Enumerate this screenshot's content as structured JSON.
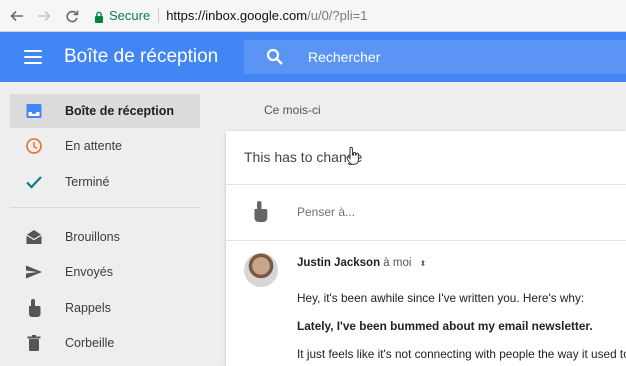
{
  "browser": {
    "secure_label": "Secure",
    "url_host": "https://inbox.google.com",
    "url_path": "/u/0/?pli=1"
  },
  "header": {
    "title": "Boîte de réception",
    "search_placeholder": "Rechercher"
  },
  "sidebar": {
    "items": [
      {
        "label": "Boîte de réception",
        "icon": "inbox-icon",
        "active": true
      },
      {
        "label": "En attente",
        "icon": "clock-icon"
      },
      {
        "label": "Terminé",
        "icon": "checkmark-icon"
      },
      {
        "label": "Brouillons",
        "icon": "draft-envelope-icon"
      },
      {
        "label": "Envoyés",
        "icon": "send-icon"
      },
      {
        "label": "Rappels",
        "icon": "reminder-finger-icon"
      },
      {
        "label": "Corbeille",
        "icon": "trash-icon"
      }
    ]
  },
  "main": {
    "section_label": "Ce mois-ci",
    "subject": "This has to change",
    "reminder_placeholder": "Penser à...",
    "message": {
      "sender": "Justin Jackson",
      "recipient": "à moi",
      "lines": [
        "Hey, it's been awhile since I've written you. Here's why:",
        "Lately, I've been bummed about my email newsletter.",
        "It just feels like it's not connecting with people the way it used to."
      ]
    }
  },
  "colors": {
    "header_blue": "#4285f4",
    "secure_green": "#0b8043",
    "check_teal": "#0a7f83",
    "clock_orange": "#e67c3c"
  }
}
